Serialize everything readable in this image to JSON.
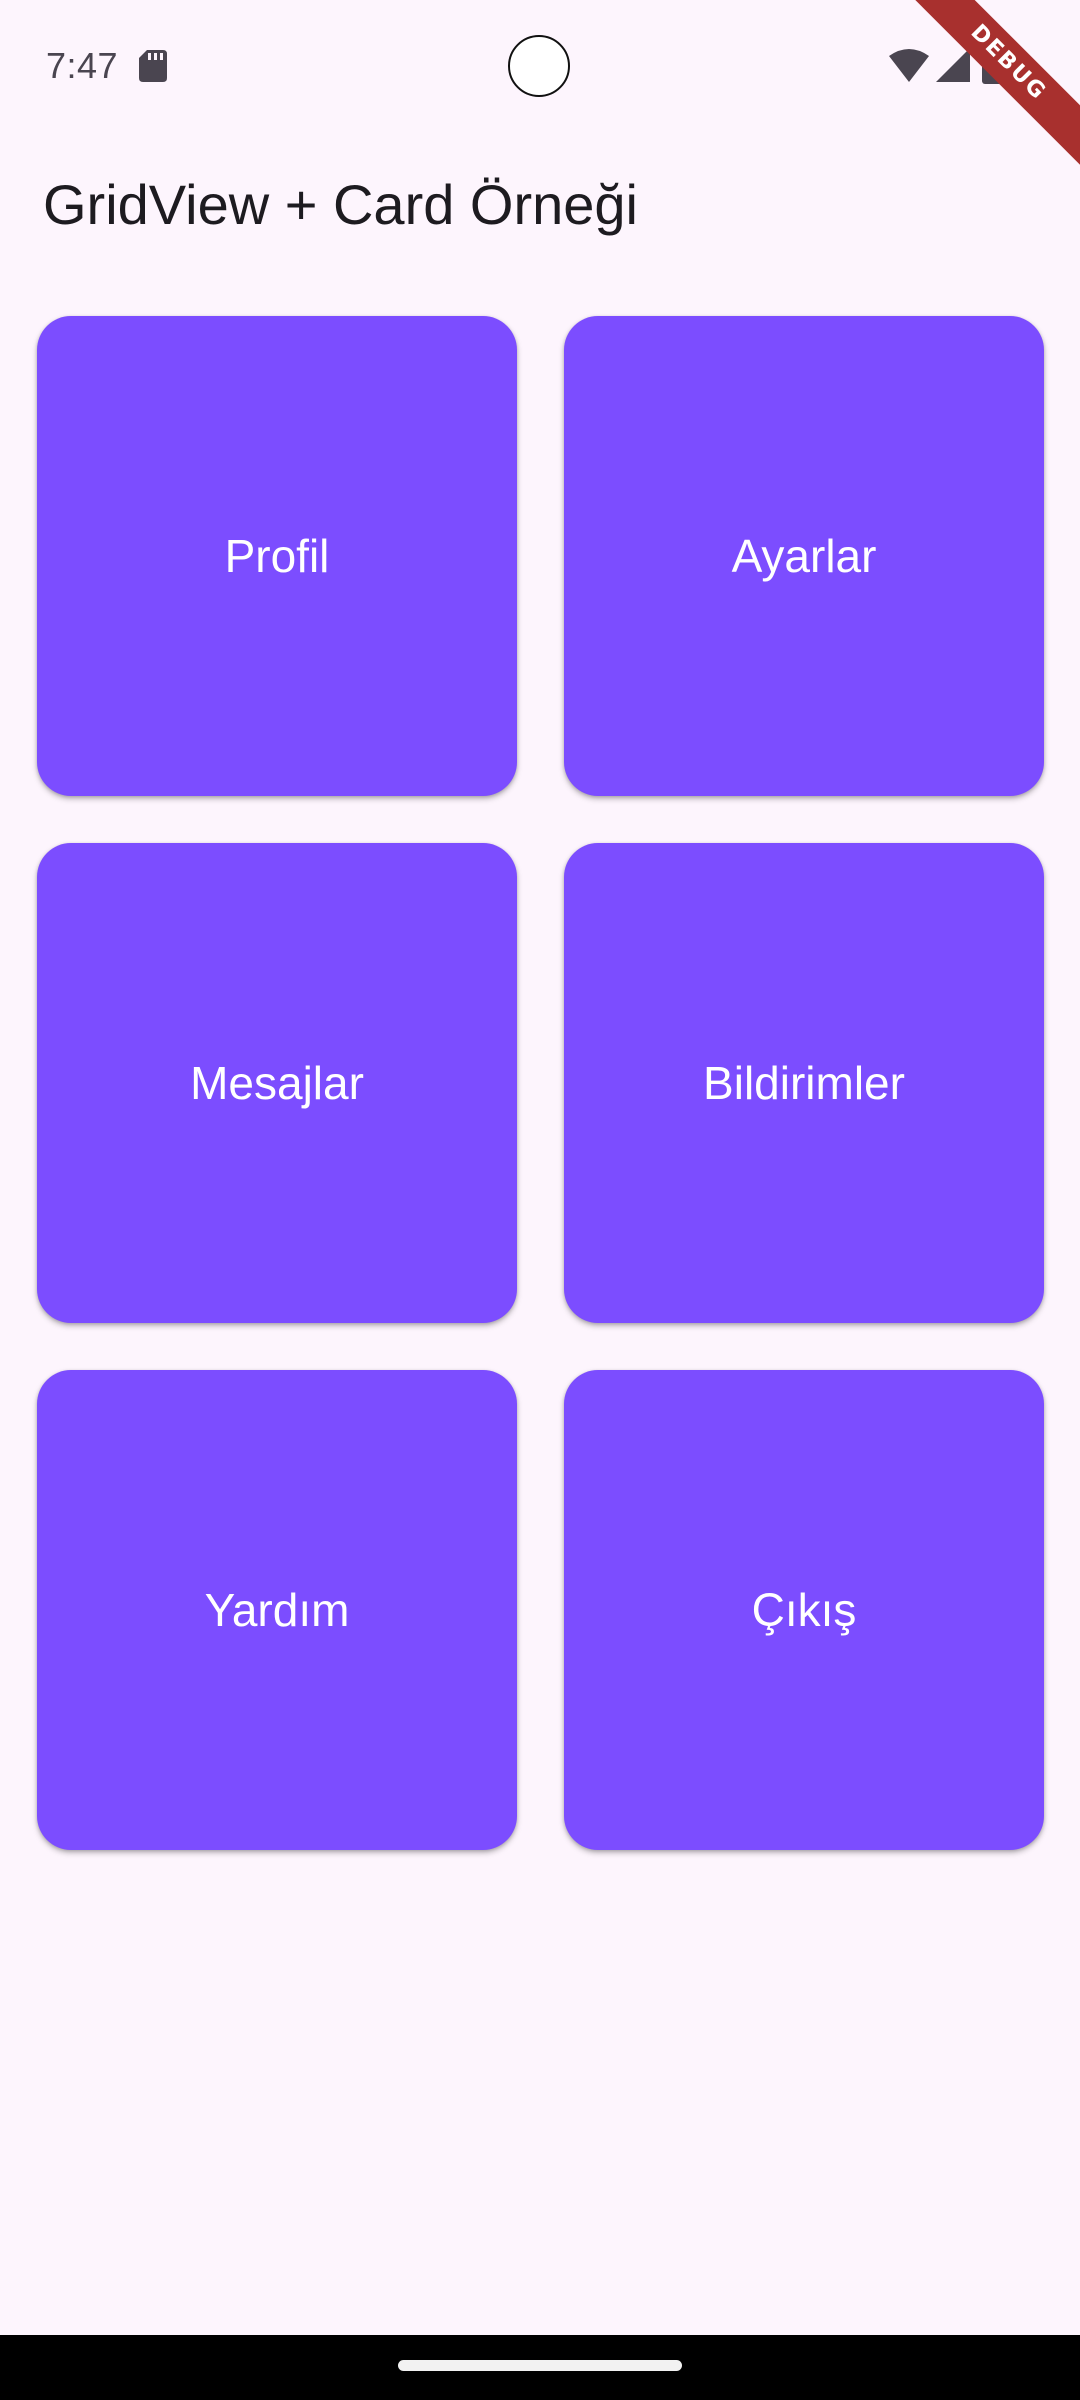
{
  "status_bar": {
    "time": "7:47",
    "icons": [
      "sd-card-icon",
      "wifi-icon",
      "signal-icon",
      "battery-icon"
    ]
  },
  "debug_banner": {
    "label": "DEBUG",
    "color": "#a8302e"
  },
  "app_bar": {
    "title": "GridView + Card Örneği"
  },
  "colors": {
    "background": "#fdf5fd",
    "card": "#7c4dff",
    "card_text": "#ffffff",
    "title_text": "#1d1b20"
  },
  "grid": {
    "cards": [
      {
        "label": "Profil"
      },
      {
        "label": "Ayarlar"
      },
      {
        "label": "Mesajlar"
      },
      {
        "label": "Bildirimler"
      },
      {
        "label": "Yardım"
      },
      {
        "label": "Çıkış"
      }
    ]
  }
}
